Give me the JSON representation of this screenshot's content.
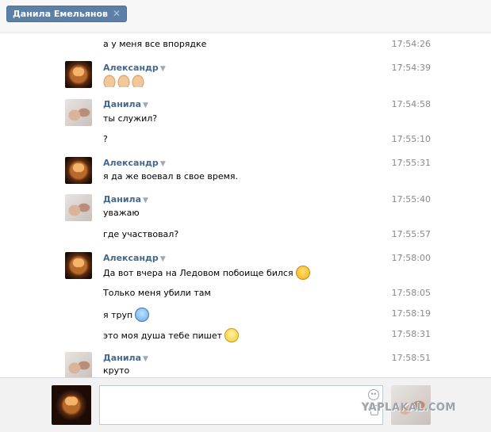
{
  "tab": {
    "label": "Данила Емельянов",
    "close": "✕"
  },
  "messages": [
    {
      "id": "m1",
      "author": "",
      "avatar": "",
      "text": "а у меня все впорядке",
      "time": "17:54:26"
    },
    {
      "id": "m2",
      "author": "Александр",
      "avatar": "skull",
      "text": "👍👍👍",
      "time": "17:54:39"
    },
    {
      "id": "m3",
      "author": "Данила",
      "avatar": "fists",
      "text": "ты служил?",
      "time": "17:54:58"
    },
    {
      "id": "m4",
      "author": "",
      "avatar": "",
      "text": "?",
      "time": "17:55:10"
    },
    {
      "id": "m5",
      "author": "Александр",
      "avatar": "skull",
      "text": "я да же воевал в свое время.",
      "time": "17:55:31"
    },
    {
      "id": "m6",
      "author": "Данила",
      "avatar": "fists",
      "text": "уважаю",
      "time": "17:55:40"
    },
    {
      "id": "m7",
      "author": "",
      "avatar": "",
      "text": "где участвовал?",
      "time": "17:55:57"
    },
    {
      "id": "m8",
      "author": "Александр",
      "avatar": "skull",
      "text": "Да вот вчера на Ледовом побоище бился",
      "emoji": "laugh-emoji",
      "time": "17:58:00"
    },
    {
      "id": "m9",
      "author": "",
      "avatar": "",
      "text": "Только меня убили там",
      "time": "17:58:05"
    },
    {
      "id": "m10",
      "author": "",
      "avatar": "",
      "text": "я труп",
      "emoji": "scared-emoji",
      "time": "17:58:19"
    },
    {
      "id": "m11",
      "author": "",
      "avatar": "",
      "text": "это моя душа тебе пишет",
      "emoji": "shocked-emoji",
      "time": "17:58:31"
    },
    {
      "id": "m12",
      "author": "Данила",
      "avatar": "fists",
      "text": "круто",
      "time": "17:58:51"
    }
  ],
  "caret": "▼",
  "compose": {
    "placeholder": "",
    "smile_icon": "smile-icon",
    "attach_icon": "attach-icon"
  },
  "watermark": "YAPLAKAL.COM",
  "colors": {
    "author": "#45688e",
    "tab_bg": "#5b7fa6",
    "time": "#8a8a8a"
  }
}
